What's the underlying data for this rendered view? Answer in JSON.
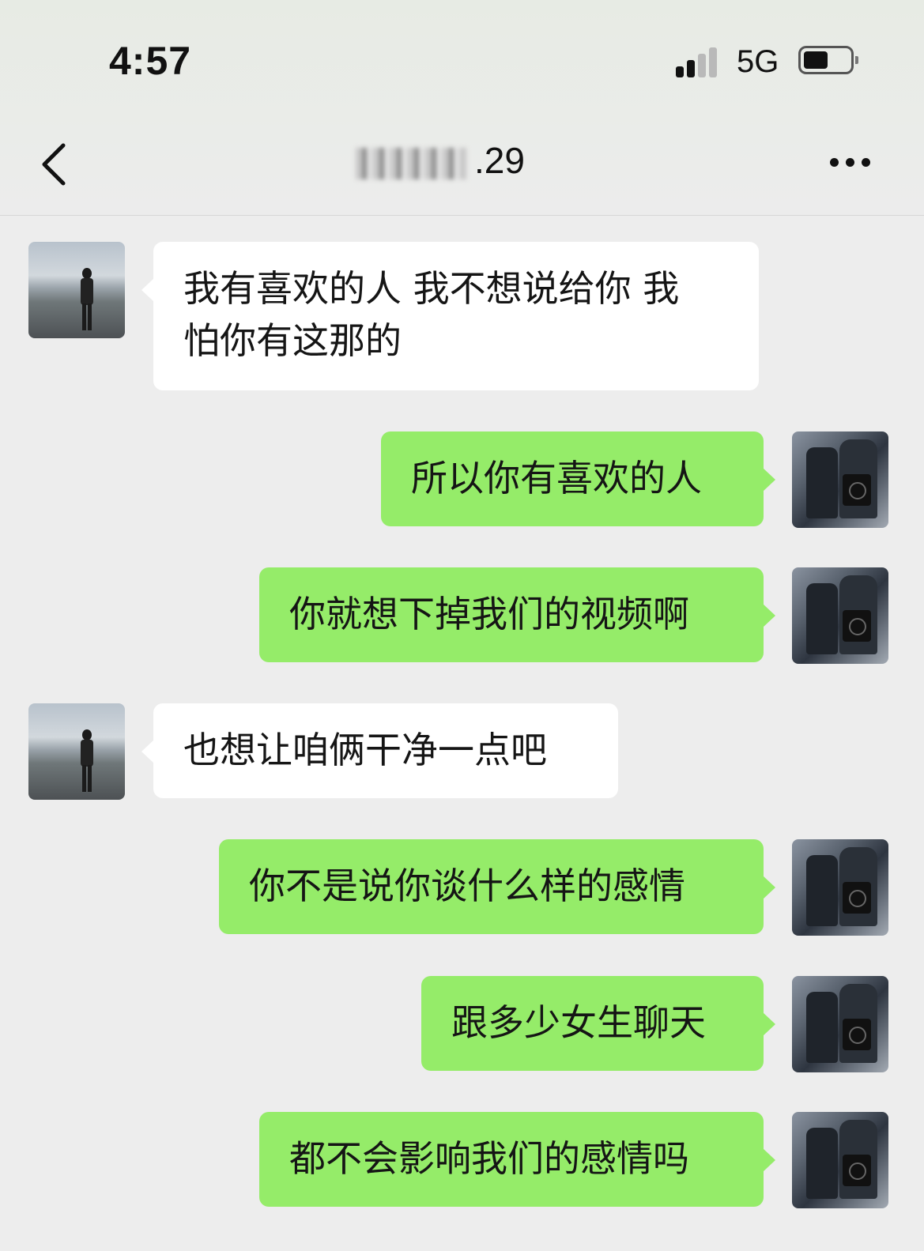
{
  "status_bar": {
    "time": "4:57",
    "network": "5G"
  },
  "header": {
    "title_visible": ".29",
    "icons": [
      "back-chevron-icon",
      "more-dots-icon"
    ]
  },
  "colors": {
    "background": "#ededed",
    "incoming_bubble": "#ffffff",
    "outgoing_bubble": "#95ec69"
  },
  "messages": [
    {
      "side": "left",
      "lines": [
        "我有喜欢的人 我不想说给你 我",
        "怕你有这那的"
      ]
    },
    {
      "side": "right",
      "lines": [
        "所以你有喜欢的人"
      ]
    },
    {
      "side": "right",
      "lines": [
        "你就想下掉我们的视频啊"
      ]
    },
    {
      "side": "left",
      "lines": [
        "也想让咱俩干净一点吧"
      ]
    },
    {
      "side": "right",
      "lines": [
        "你不是说你谈什么样的感情"
      ]
    },
    {
      "side": "right",
      "lines": [
        "跟多少女生聊天"
      ]
    },
    {
      "side": "right",
      "lines": [
        "都不会影响我们的感情吗"
      ]
    }
  ]
}
